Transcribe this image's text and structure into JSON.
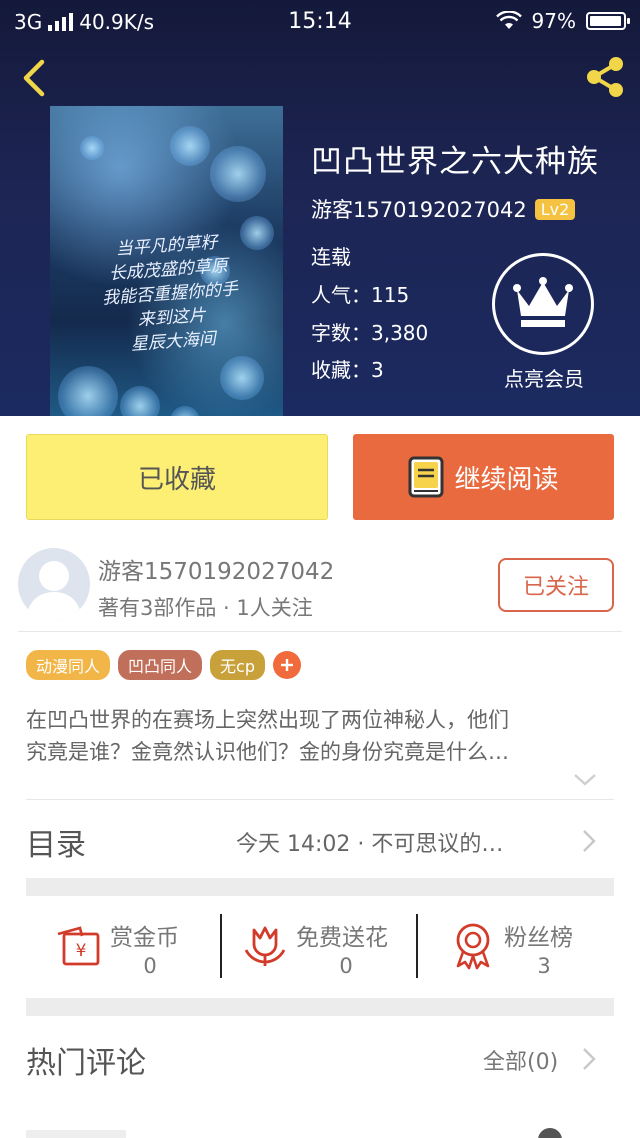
{
  "status_bar": {
    "network": "3G",
    "speed": "40.9K/s",
    "time": "15:14",
    "battery": "97%",
    "battery_level": 0.97
  },
  "book": {
    "title": "凹凸世界之六大种族",
    "author": "游客1570192027042",
    "level": "Lv2",
    "status": "连载",
    "popularity": "人气：115",
    "words": "字数：3,380",
    "favorites": "收藏：3",
    "vip_label": "点亮会员",
    "cover_poem": [
      "当平凡的草籽",
      "长成茂盛的草原",
      "我能否重握你的手",
      "来到这片",
      "星辰大海间"
    ]
  },
  "actions": {
    "favorited_label": "已收藏",
    "continue_label": "继续阅读"
  },
  "author_card": {
    "name": "游客1570192027042",
    "summary": "著有3部作品 · 1人关注",
    "follow_label": "已关注"
  },
  "tags": [
    {
      "label": "动漫同人",
      "color": "#f2b648"
    },
    {
      "label": "凹凸同人",
      "color": "#c0705a"
    },
    {
      "label": "无cp",
      "color": "#c8a13a"
    }
  ],
  "synopsis": [
    "在凹凸世界的在赛场上突然出现了两位神秘人，他们",
    "究竟是谁？金竟然认识他们？金的身份究竟是什么…"
  ],
  "catalog": {
    "title": "目录",
    "latest": "今天 14:02 · 不可思议的…"
  },
  "stats": [
    {
      "label": "赏金币",
      "value": "0",
      "icon": "reward-coin-icon"
    },
    {
      "label": "免费送花",
      "value": "0",
      "icon": "flower-icon"
    },
    {
      "label": "粉丝榜",
      "value": "3",
      "icon": "medal-icon"
    }
  ],
  "comments": {
    "title": "热门评论",
    "all_label": "全部(0)"
  },
  "colors": {
    "header_bg": "#1b2454",
    "accent_orange": "#e86a3e",
    "favorite_yellow": "#fcef74",
    "icon_red": "#d23b2a",
    "lv_badge": "#f5c242"
  }
}
